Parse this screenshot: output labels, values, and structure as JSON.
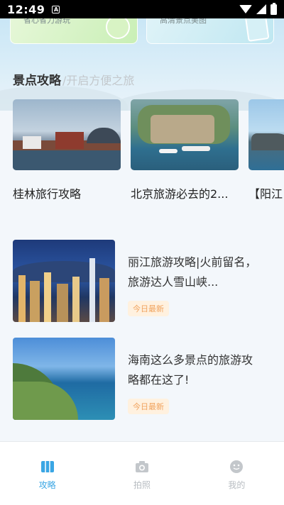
{
  "status_bar": {
    "time": "12:49",
    "app_icon_letter": "A"
  },
  "top_categories": [
    {
      "label": "省心省力游玩"
    },
    {
      "label": "高清景点美图"
    }
  ],
  "section": {
    "title": "景点攻略",
    "subtitle": "/开启方便之旅"
  },
  "featured_guides": [
    {
      "title": "桂林旅行攻略",
      "image": "harbor-village"
    },
    {
      "title": "北京旅游必去的2...",
      "image": "aerial-fortress"
    },
    {
      "title": "【阳江",
      "image": "rocky-coast"
    }
  ],
  "guide_list": [
    {
      "title": "丽江旅游攻略|火前留名，旅游达人雪山峡...",
      "badge": "今日最新",
      "image": "city-night"
    },
    {
      "title": "海南这么多景点的旅游攻略都在这了!",
      "badge": "今日最新",
      "image": "island-coast"
    }
  ],
  "bottom_nav": [
    {
      "label": "攻略",
      "icon": "map-icon",
      "active": true
    },
    {
      "label": "拍照",
      "icon": "camera-icon",
      "active": false
    },
    {
      "label": "我的",
      "icon": "user-icon",
      "active": false
    }
  ],
  "colors": {
    "accent": "#3aa6e4",
    "badge_bg": "#fff1df",
    "badge_text": "#f0a35e"
  }
}
